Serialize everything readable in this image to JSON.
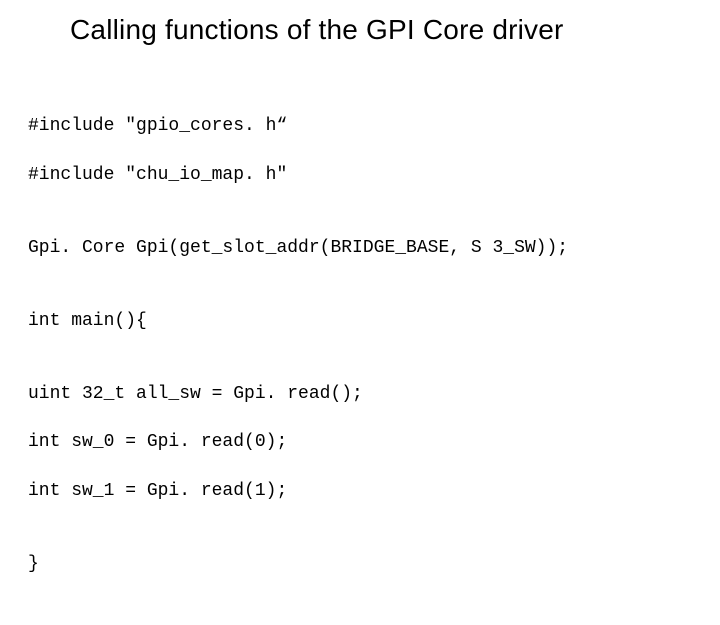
{
  "title": "Calling functions of the GPI Core driver",
  "code": {
    "l1": "#include \"gpio_cores. h“",
    "l2": "#include \"chu_io_map. h\"",
    "l3": "",
    "l4": "Gpi. Core Gpi(get_slot_addr(BRIDGE_BASE, S 3_SW));",
    "l5": "",
    "l6": "int main(){",
    "l7": "",
    "l8": "uint 32_t all_sw = Gpi. read();",
    "l9": "int sw_0 = Gpi. read(0);",
    "l10": "int sw_1 = Gpi. read(1);",
    "l11": "",
    "l12": "}"
  }
}
